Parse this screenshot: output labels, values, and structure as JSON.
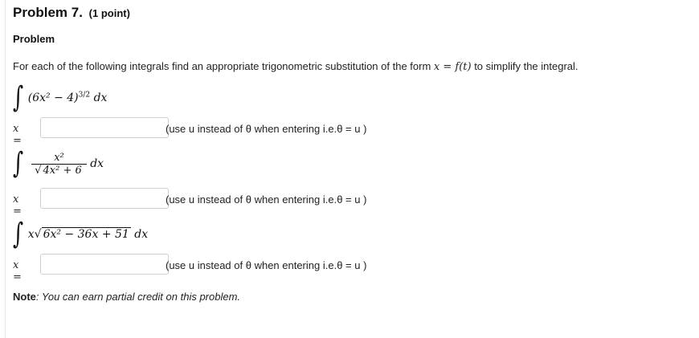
{
  "problem": {
    "title": "Problem 7.",
    "points": "(1 point)",
    "subheading": "Problem",
    "instructions_pre": "For each of the following integrals find an appropriate trigonometric substitution of the form ",
    "instructions_math": "x = f(t)",
    "instructions_post": " to simplify the integral."
  },
  "integrals": [
    {
      "integrand": "(6x² − 4)",
      "exponent": "3/2",
      "dx": "dx"
    },
    {
      "numerator": "x²",
      "denominator": "4x² + 6",
      "dx": "dx"
    },
    {
      "lead": "x",
      "radicand": "6x² − 36x + 51",
      "dx": "dx"
    }
  ],
  "answers": [
    {
      "label": "x =",
      "value": "",
      "hint": "(use u instead of θ when entering i.e.θ = u )"
    },
    {
      "label": "x =",
      "value": "",
      "hint": "(use u instead of θ when entering i.e.θ = u )"
    },
    {
      "label": "x =",
      "value": "",
      "hint": "(use u instead of θ when entering i.e.θ = u )"
    }
  ],
  "note": {
    "label": "Note",
    "text": ": You can earn partial credit on this problem."
  }
}
